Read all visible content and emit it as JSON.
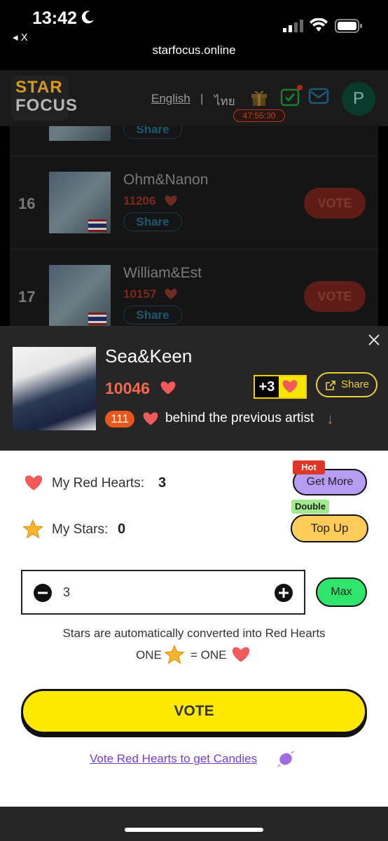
{
  "status_bar": {
    "time": "13:42",
    "back_label": "◂ X",
    "url": "starfocus.online"
  },
  "header": {
    "logo_line1": "STAR",
    "logo_line2": "FOCUS",
    "lang_en": "English",
    "lang_sep": "|",
    "lang_th": "ไทย",
    "timer": "47:55:30",
    "avatar_letter": "P"
  },
  "list": {
    "rows": [
      {
        "rank": "16",
        "name": "Ohm&Nanon",
        "count": "11206",
        "share": "Share",
        "vote": "VOTE"
      },
      {
        "rank": "17",
        "name": "William&Est",
        "count": "10157",
        "share": "Share",
        "vote": "VOTE"
      }
    ],
    "partial_share": "Share"
  },
  "artist_panel": {
    "name": "Sea&Keen",
    "count": "10046",
    "bonus": "+3",
    "share_label": "Share",
    "behind_count": "111",
    "behind_text": "behind the previous artist",
    "arrow": "↓"
  },
  "vote_sheet": {
    "red_hearts_label": "My Red Hearts:",
    "red_hearts_value": "3",
    "get_more_label": "Get More",
    "hot_badge": "Hot",
    "stars_label": "My Stars:",
    "stars_value": "0",
    "top_up_label": "Top Up",
    "double_badge": "Double",
    "quantity": "3",
    "max_label": "Max",
    "note_line1": "Stars are automatically converted into Red Hearts",
    "note_one_left": "ONE",
    "note_one_right": "= ONE",
    "vote_label": "VOTE",
    "candies_link": "Vote Red Hearts to get Candies"
  },
  "colors": {
    "accent_yellow": "#ffe900",
    "heart_red": "#f05a5a",
    "get_more_purple": "#b59df2",
    "top_up_orange": "#ffcc5a",
    "max_green": "#2fe56b",
    "link_purple": "#7a3cc8"
  }
}
